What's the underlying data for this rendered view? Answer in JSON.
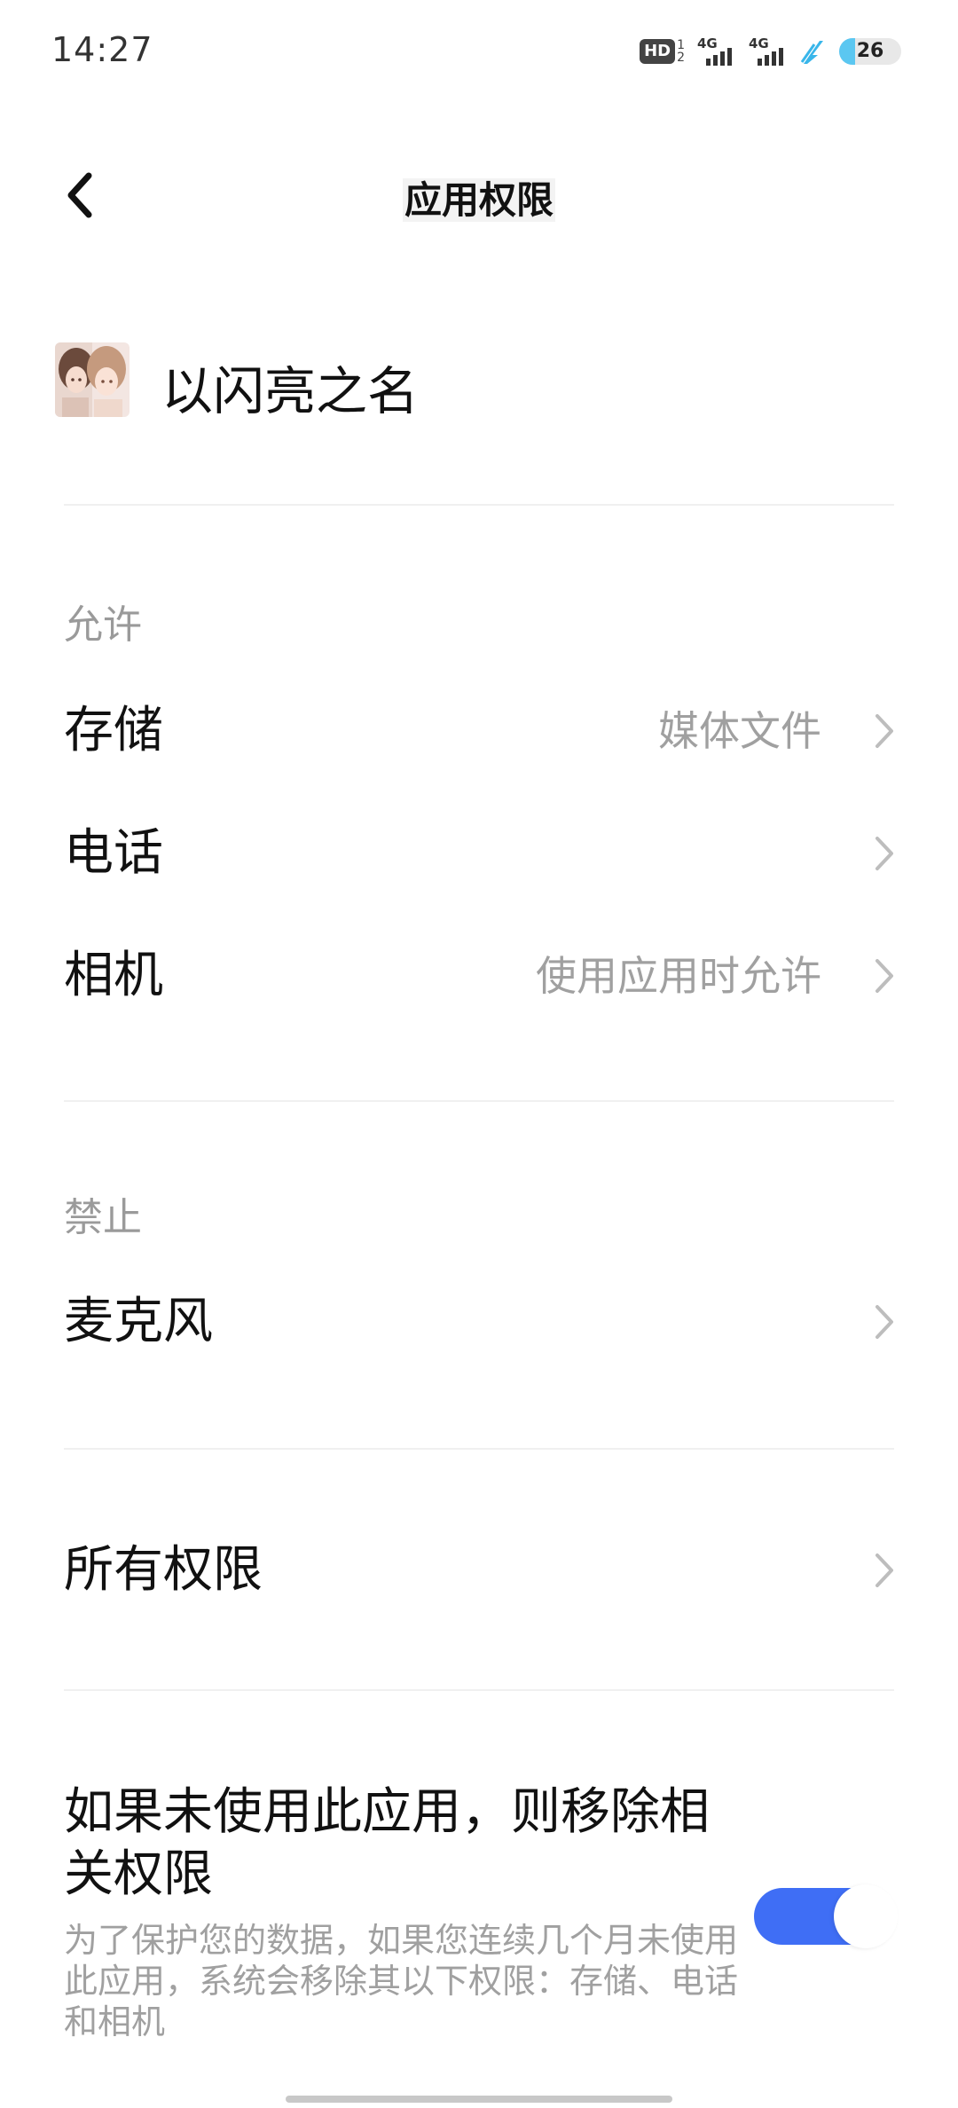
{
  "status_bar": {
    "time": "14:27",
    "hd_label": "HD",
    "hd_sub_top": "1",
    "hd_sub_bottom": "2",
    "sim1_label": "4G",
    "sim2_label": "4G",
    "battery_level": "26",
    "battery_fraction": 0.26,
    "battery_color": "#5bc7f1"
  },
  "header": {
    "title": "应用权限",
    "back_icon": "chevron-left-icon"
  },
  "app": {
    "name": "以闪亮之名",
    "icon": "app-icon"
  },
  "sections": {
    "allowed": {
      "label": "允许",
      "items": [
        {
          "label": "存储",
          "value": "媒体文件"
        },
        {
          "label": "电话",
          "value": ""
        },
        {
          "label": "相机",
          "value": "使用应用时允许"
        }
      ]
    },
    "denied": {
      "label": "禁止",
      "items": [
        {
          "label": "麦克风",
          "value": ""
        }
      ]
    }
  },
  "all_permissions": {
    "label": "所有权限"
  },
  "auto_revoke": {
    "title": "如果未使用此应用，则移除相关权限",
    "description": "为了保护您的数据，如果您连续几个月未使用此应用，系统会移除其以下权限：存储、电话和相机",
    "enabled": true,
    "accent_color": "#3f6ef5"
  }
}
